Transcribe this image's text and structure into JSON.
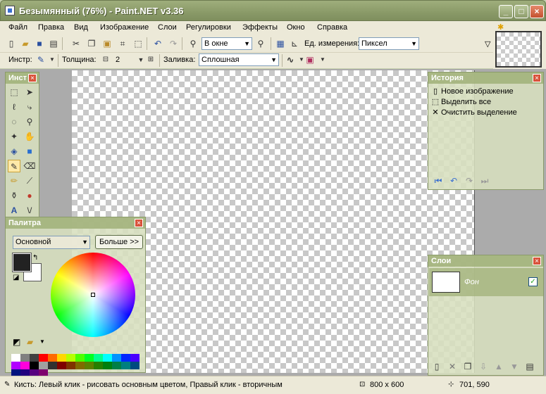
{
  "window": {
    "title": "Безымянный (76%) - Paint.NET v3.36"
  },
  "menu": [
    "Файл",
    "Правка",
    "Вид",
    "Изображение",
    "Слои",
    "Регулировки",
    "Эффекты",
    "Окно",
    "Справка"
  ],
  "toolbar": {
    "zoom_value": "В окне",
    "units_label": "Ед. измерения:",
    "units_value": "Пиксел"
  },
  "toolbar2": {
    "tool_label": "Инстр:",
    "width_label": "Толщина:",
    "width_value": "2",
    "fill_label": "Заливка:",
    "fill_value": "Сплошная"
  },
  "tools_window": {
    "title": "Инст"
  },
  "history": {
    "title": "История",
    "items": [
      "Новое изображение",
      "Выделить все",
      "Очистить выделение"
    ]
  },
  "layers": {
    "title": "Слои",
    "items": [
      {
        "name": "Фон",
        "visible": true
      }
    ]
  },
  "palette": {
    "title": "Палитра",
    "mode": "Основной",
    "more_button": "Больше >>",
    "primary_color": "#222222",
    "secondary_color": "#ffffff",
    "swatches": [
      "#ffffff",
      "#808080",
      "#404040",
      "#ff0000",
      "#ff6a00",
      "#ffd800",
      "#b6ff00",
      "#4cff00",
      "#00ff21",
      "#00ff90",
      "#00ffff",
      "#0094ff",
      "#0026ff",
      "#4800ff",
      "#b200ff",
      "#ff00dc",
      "#000000",
      "#a0a0a0",
      "#303030",
      "#7f0000",
      "#7f3300",
      "#7f6a00",
      "#5b7f00",
      "#267f00",
      "#007f0e",
      "#007f46",
      "#007f7f",
      "#004a7f",
      "#00137f",
      "#21007f",
      "#57007f",
      "#7f006e"
    ]
  },
  "status": {
    "hint": "Кисть: Левый клик - рисовать основным цветом, Правый клик - вторичным",
    "image_size": "800 x 600",
    "cursor_pos": "701, 590"
  }
}
